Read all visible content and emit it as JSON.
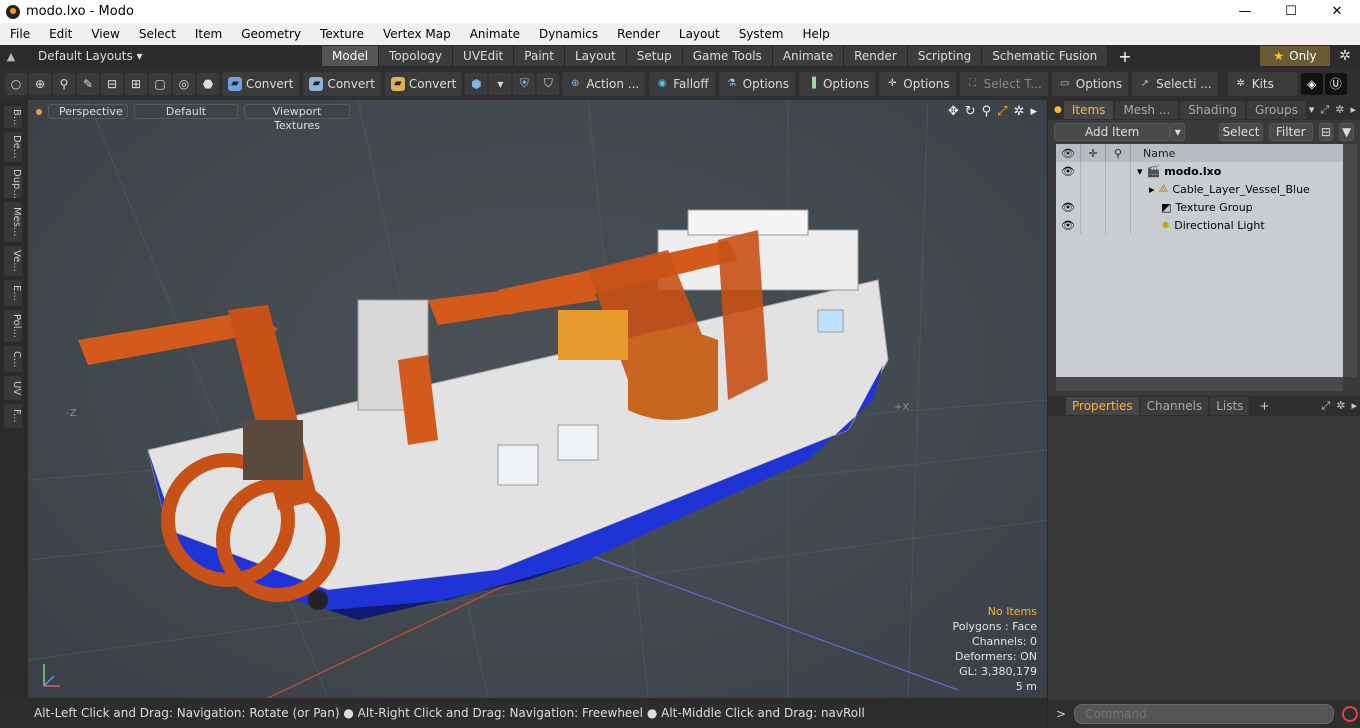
{
  "window": {
    "title": "modo.lxo - Modo",
    "minimize": "—",
    "maximize": "☐",
    "close": "✕"
  },
  "menu": [
    "File",
    "Edit",
    "View",
    "Select",
    "Item",
    "Geometry",
    "Texture",
    "Vertex Map",
    "Animate",
    "Dynamics",
    "Render",
    "Layout",
    "System",
    "Help"
  ],
  "layout": {
    "dropdown": "Default Layouts ▾",
    "tabs": [
      "Model",
      "Topology",
      "UVEdit",
      "Paint",
      "Layout",
      "Setup",
      "Game Tools",
      "Animate",
      "Render",
      "Scripting",
      "Schematic Fusion"
    ],
    "active_tab": "Model",
    "only_label": "Only"
  },
  "toolbar": {
    "convert1": "Convert",
    "convert2": "Convert",
    "convert3": "Convert",
    "action": "Action ...",
    "falloff": "Falloff",
    "options1": "Options",
    "options2": "Options",
    "options3": "Options",
    "options4": "Options",
    "select_t": "Select T...",
    "selecti": "Selecti ...",
    "kits": "Kits"
  },
  "left_tabs": [
    "B...",
    "De...",
    "Dup...",
    "Mes...",
    "Ve...",
    "E...",
    "Pol...",
    "C...",
    "UV",
    "F..."
  ],
  "viewport": {
    "perspective": "Perspective",
    "default": "Default",
    "textures": "Viewport Textures",
    "axis_neg_z": "-Z",
    "axis_pos_x": "+X",
    "stats": {
      "no_items": "No Items",
      "polygons": "Polygons : Face",
      "channels": "Channels: 0",
      "deformers": "Deformers: ON",
      "gl": "GL: 3,380,179",
      "scale": "5 m"
    }
  },
  "statusbar": "Alt-Left Click and Drag: Navigation: Rotate (or Pan) ● Alt-Right Click and Drag: Navigation: Freewheel ● Alt-Middle Click and Drag: navRoll",
  "items_panel": {
    "tabs": [
      "Items",
      "Mesh ...",
      "Shading",
      "Groups"
    ],
    "add_item": "Add Item",
    "select": "Select",
    "filter": "Filter",
    "name_header": "Name",
    "rows": [
      {
        "name": "modo.lxo",
        "bold": true
      },
      {
        "name": "Cable_Layer_Vessel_Blue"
      },
      {
        "name": "Texture Group"
      },
      {
        "name": "Directional Light"
      }
    ]
  },
  "props_panel": {
    "tabs": [
      "Properties",
      "Channels",
      "Lists"
    ]
  },
  "command": {
    "placeholder": "Command"
  }
}
